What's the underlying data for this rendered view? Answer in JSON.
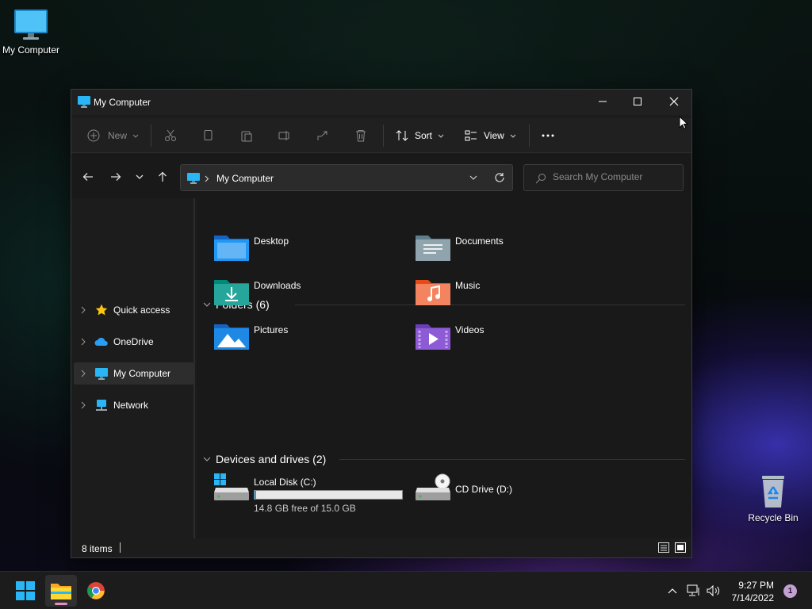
{
  "desktop": {
    "icons": [
      {
        "label": "My Computer"
      },
      {
        "label": "Recycle Bin"
      }
    ]
  },
  "window": {
    "title": "My Computer",
    "controls": {
      "minimize": "minimize-icon",
      "maximize": "maximize-icon",
      "close": "close-icon"
    }
  },
  "toolbar": {
    "new_label": "New",
    "sort_label": "Sort",
    "view_label": "View",
    "icons": [
      "plus-icon",
      "cut-icon",
      "copy-icon",
      "paste-icon",
      "rename-icon",
      "share-icon",
      "delete-icon",
      "sort-icon",
      "view-icon",
      "more-icon"
    ]
  },
  "address": {
    "path": "My Computer",
    "search_placeholder": "Search My Computer"
  },
  "sidebar": {
    "items": [
      {
        "label": "Quick access",
        "icon": "star-icon"
      },
      {
        "label": "OneDrive",
        "icon": "cloud-icon"
      },
      {
        "label": "My Computer",
        "icon": "computer-icon",
        "selected": true
      },
      {
        "label": "Network",
        "icon": "network-icon"
      }
    ]
  },
  "content": {
    "folders_header": "Folders (6)",
    "folders": [
      {
        "name": "Desktop"
      },
      {
        "name": "Documents"
      },
      {
        "name": "Downloads"
      },
      {
        "name": "Music"
      },
      {
        "name": "Pictures"
      },
      {
        "name": "Videos"
      }
    ],
    "drives_header": "Devices and drives (2)",
    "drives": [
      {
        "name": "Local Disk (C:)",
        "free_text": "14.8 GB free of 15.0 GB",
        "used_fraction": 0.013
      },
      {
        "name": "CD Drive (D:)"
      }
    ]
  },
  "status": {
    "item_count": "8 items"
  },
  "taskbar": {
    "time": "9:27 PM",
    "date": "7/14/2022",
    "notification_count": "1"
  },
  "colors": {
    "accent": "#1aa0e8",
    "window_bg": "#1c1c1c",
    "folder_blue": "#2196f3",
    "folder_green": "#26a69a",
    "folder_orange": "#f4845f",
    "folder_purple": "#8e5bd6"
  }
}
